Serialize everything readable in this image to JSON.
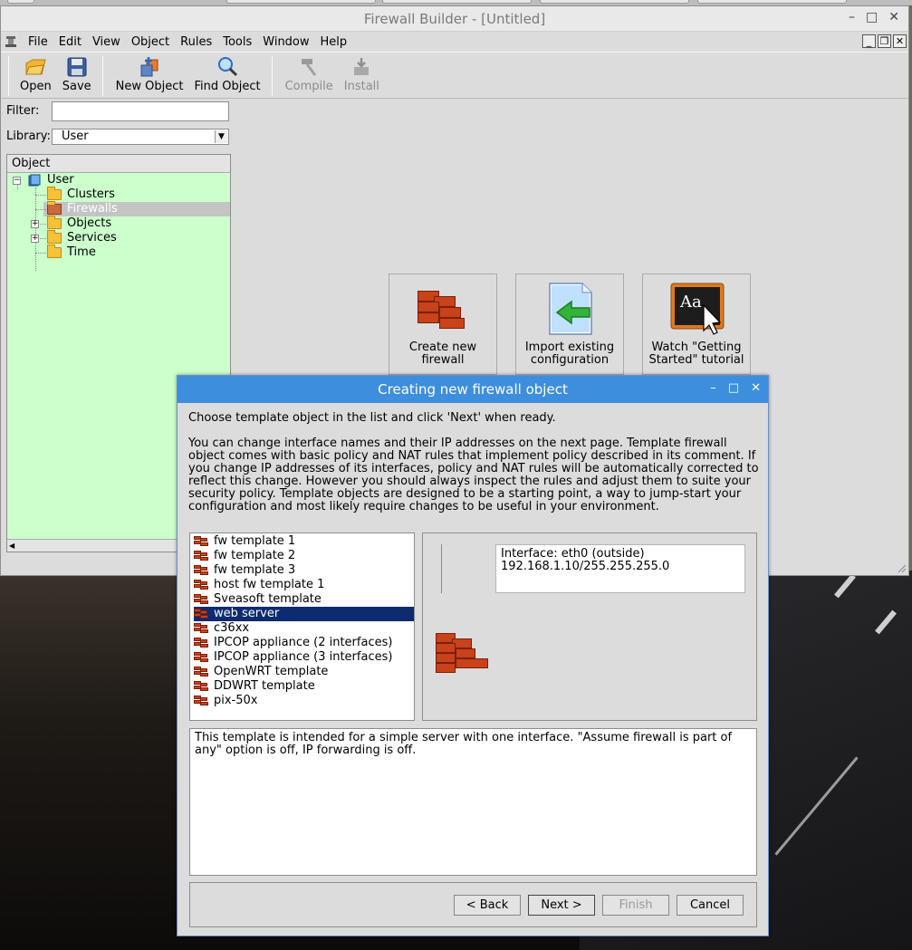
{
  "window": {
    "title": "Firewall Builder - [Untitled]"
  },
  "menu": [
    "File",
    "Edit",
    "View",
    "Object",
    "Rules",
    "Tools",
    "Window",
    "Help"
  ],
  "toolbar": {
    "open": "Open",
    "save": "Save",
    "new_object": "New Object",
    "find_object": "Find Object",
    "compile": "Compile",
    "install": "Install"
  },
  "left": {
    "filter_label": "Filter:",
    "filter_value": "",
    "library_label": "Library:",
    "library_value": "User",
    "tree_header": "Object",
    "tree": {
      "root": "User",
      "items": [
        "Clusters",
        "Firewalls",
        "Objects",
        "Services",
        "Time"
      ],
      "selected": "Firewalls"
    }
  },
  "welcome": {
    "create": "Create new firewall",
    "import": "Import existing configuration",
    "watch": "Watch \"Getting Started\" tutorial",
    "watch_icon_text": "Aa"
  },
  "dialog": {
    "title": "Creating new firewall object",
    "intro": "Choose template object in the list and click 'Next' when ready.",
    "body": "You can change  interface names and their IP addresses on the next page. Template firewall object comes with basic policy and NAT rules that implement policy described in its comment. If you change IP addresses of its interfaces, policy and NAT rules will be automatically corrected to reflect this change. However you should always inspect the rules and adjust them to suite your security policy. Template objects are designed to be a starting point, a way to jump-start your configuration and most likely require changes to be useful in your environment.",
    "templates": [
      "fw template 1",
      "fw template 2",
      "fw template 3",
      "host fw template 1",
      "Sveasoft template",
      "web server",
      "c36xx",
      "IPCOP appliance (2 interfaces)",
      "IPCOP appliance (3 interfaces)",
      "OpenWRT template",
      "DDWRT template",
      "pix-50x"
    ],
    "selected_template": "web server",
    "interface_line1": "Interface: eth0 (outside)",
    "interface_line2": "192.168.1.10/255.255.255.0",
    "description": "This template is intended for a simple server with one interface. \"Assume firewall is part of any\" option is off, IP forwarding is off.",
    "buttons": {
      "back": "< Back",
      "next": "Next >",
      "finish": "Finish",
      "cancel": "Cancel"
    }
  }
}
